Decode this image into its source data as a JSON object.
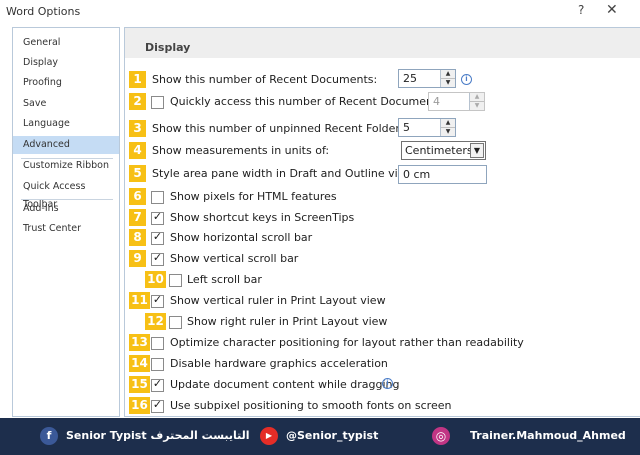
{
  "window": {
    "title": "Word Options",
    "help": "?",
    "close": "✕"
  },
  "sidebar": {
    "items": [
      {
        "label": "General"
      },
      {
        "label": "Display"
      },
      {
        "label": "Proofing"
      },
      {
        "label": "Save"
      },
      {
        "label": "Language"
      },
      {
        "label": "Advanced",
        "selected": true
      },
      {
        "label": "Customize Ribbon"
      },
      {
        "label": "Quick Access Toolbar"
      },
      {
        "label": "Add-Ins"
      },
      {
        "label": "Trust Center"
      }
    ]
  },
  "section": {
    "title": "Display"
  },
  "rows": [
    {
      "num": "1",
      "label": "Show this number of Recent Documents:",
      "control": "spin",
      "value": "25",
      "info": true
    },
    {
      "num": "2",
      "label": "Quickly access this number of Recent Documents:",
      "control": "checkbox+spin",
      "checked": false,
      "value": "4",
      "disabled": true
    },
    {
      "num": "3",
      "label": "Show this number of unpinned Recent Folders:",
      "control": "spin",
      "value": "5"
    },
    {
      "num": "4",
      "label": "Show measurements in units of:",
      "control": "dropdown",
      "value": "Centimeters"
    },
    {
      "num": "5",
      "label": "Style area pane width in Draft and Outline views:",
      "control": "text",
      "value": "0 cm"
    },
    {
      "num": "6",
      "label": "Show pixels for HTML features",
      "control": "checkbox",
      "checked": false
    },
    {
      "num": "7",
      "label": "Show shortcut keys in ScreenTips",
      "control": "checkbox",
      "checked": true
    },
    {
      "num": "8",
      "label": "Show horizontal scroll bar",
      "control": "checkbox",
      "checked": true
    },
    {
      "num": "9",
      "label": "Show vertical scroll bar",
      "control": "checkbox",
      "checked": true
    },
    {
      "num": "10",
      "label": "Left scroll bar",
      "control": "checkbox",
      "checked": false
    },
    {
      "num": "11",
      "label": "Show vertical ruler in Print Layout view",
      "control": "checkbox",
      "checked": true
    },
    {
      "num": "12",
      "label": "Show right ruler in Print Layout view",
      "control": "checkbox",
      "checked": false
    },
    {
      "num": "13",
      "label": "Optimize character positioning for layout rather than readability",
      "control": "checkbox",
      "checked": false
    },
    {
      "num": "14",
      "label": "Disable hardware graphics acceleration",
      "control": "checkbox",
      "checked": false
    },
    {
      "num": "15",
      "label": "Update document content while dragging",
      "control": "checkbox",
      "checked": true,
      "info": true
    },
    {
      "num": "16",
      "label": "Use subpixel positioning to smooth fonts on screen",
      "control": "checkbox",
      "checked": true
    }
  ],
  "footer": {
    "facebook": "Senior Typist التايبست المحترف",
    "youtube": "@Senior_typist",
    "instagram": "Trainer.Mahmoud_Ahmed"
  },
  "glyphs": {
    "check": "✓",
    "up": "▲",
    "down": "▼",
    "info": "i",
    "fb": "f",
    "yt": "▶",
    "ig": "◎"
  },
  "colors": {
    "badge": "#f7c015",
    "selected_nav": "#c5dcf4",
    "footer_bg": "#1d2e4c"
  }
}
